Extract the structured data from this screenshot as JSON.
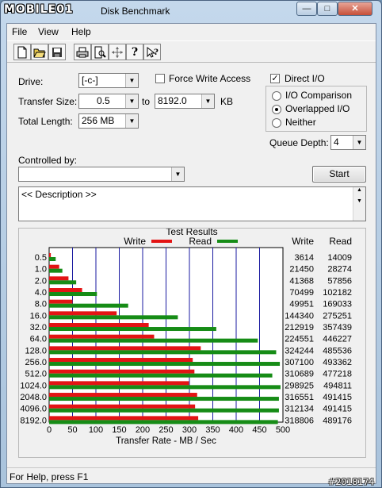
{
  "window": {
    "title": "Disk Benchmark",
    "logo_text": "MOBILE01"
  },
  "titlebar_buttons": {
    "minimize": "—",
    "maximize": "□",
    "close": "✕"
  },
  "menu": [
    "File",
    "View",
    "Help"
  ],
  "toolbar": {
    "icons": [
      "new-document-icon",
      "open-folder-icon",
      "save-icon",
      "print-icon",
      "print-preview-icon",
      "move-icon",
      "help-icon",
      "context-help-icon"
    ]
  },
  "form": {
    "drive_label": "Drive:",
    "drive_value": "[-c-]",
    "transfer_size_label": "Transfer Size:",
    "transfer_from": "0.5",
    "to_label": "to",
    "transfer_to": "8192.0",
    "kb_label": "KB",
    "total_length_label": "Total Length:",
    "total_length_value": "256 MB",
    "force_write_label": "Force Write Access",
    "force_write_checked": false,
    "direct_io_label": "Direct I/O",
    "direct_io_checked": true,
    "io_comparison_label": "I/O Comparison",
    "overlapped_io_label": "Overlapped I/O",
    "neither_label": "Neither",
    "selected_io_mode": "Overlapped I/O",
    "queue_depth_label": "Queue Depth:",
    "queue_depth_value": "4",
    "controlled_by_label": "Controlled by:",
    "controlled_by_value": "",
    "start_label": "Start",
    "description_text": "<< Description >>"
  },
  "chart_data": {
    "type": "bar",
    "title": "Test Results",
    "orientation": "horizontal",
    "categories": [
      "0.5",
      "1.0",
      "2.0",
      "4.0",
      "8.0",
      "16.0",
      "32.0",
      "64.0",
      "128.0",
      "256.0",
      "512.0",
      "1024.0",
      "2048.0",
      "4096.0",
      "8192.0"
    ],
    "series": [
      {
        "name": "Write",
        "color": "#e31414",
        "values": [
          3614,
          21450,
          41368,
          70499,
          49951,
          144340,
          212919,
          224551,
          324244,
          307100,
          310689,
          298925,
          316551,
          312134,
          318806
        ]
      },
      {
        "name": "Read",
        "color": "#168c16",
        "values": [
          14009,
          28274,
          57856,
          102182,
          169033,
          275251,
          357439,
          446227,
          485536,
          493362,
          477218,
          494811,
          491415,
          491415,
          489176
        ]
      }
    ],
    "xlabel": "Transfer Rate - MB / Sec",
    "xlim": [
      0,
      500
    ],
    "xticks": [
      "0",
      "50",
      "100",
      "150",
      "200",
      "250",
      "300",
      "350",
      "400",
      "450",
      "500"
    ],
    "table_headers": [
      "Write",
      "Read"
    ],
    "legend_position": "top",
    "grid": true
  },
  "status": {
    "help_text": "For Help, press F1"
  },
  "watermark": "#2018174"
}
